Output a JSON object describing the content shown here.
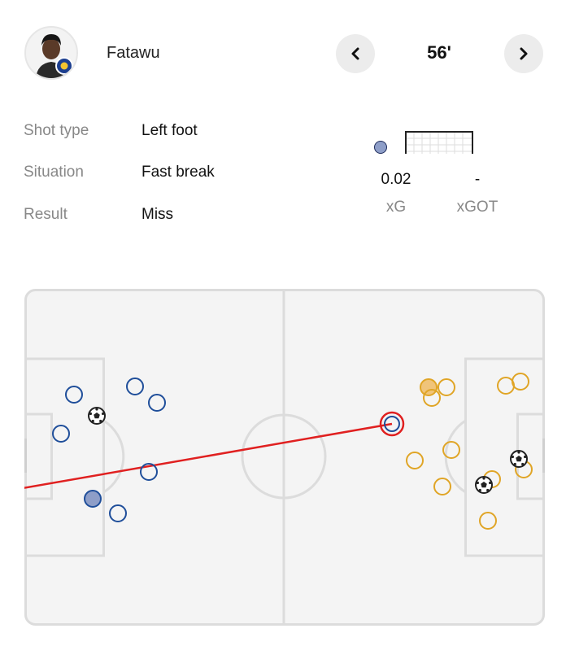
{
  "player": {
    "name": "Fatawu"
  },
  "nav": {
    "minute": "56'"
  },
  "details": [
    {
      "label": "Shot type",
      "value": "Left foot"
    },
    {
      "label": "Situation",
      "value": "Fast break"
    },
    {
      "label": "Result",
      "value": "Miss"
    }
  ],
  "stats": {
    "xg_value": "0.02",
    "xg_label": "xG",
    "xgot_value": "-",
    "xgot_label": "xGOT"
  },
  "colors": {
    "home": "#1f4e9a",
    "home_fill": "#8e9ec8",
    "away": "#e0a526",
    "away_fill": "#f0c47a",
    "shot_line": "#e02020",
    "pitch_line": "#dcdcdc",
    "pitch_bg": "#f4f4f4"
  },
  "icons": {
    "prev": "chevron-left-icon",
    "next": "chevron-right-icon",
    "ball": "ball-icon",
    "goal": "goal-icon"
  }
}
